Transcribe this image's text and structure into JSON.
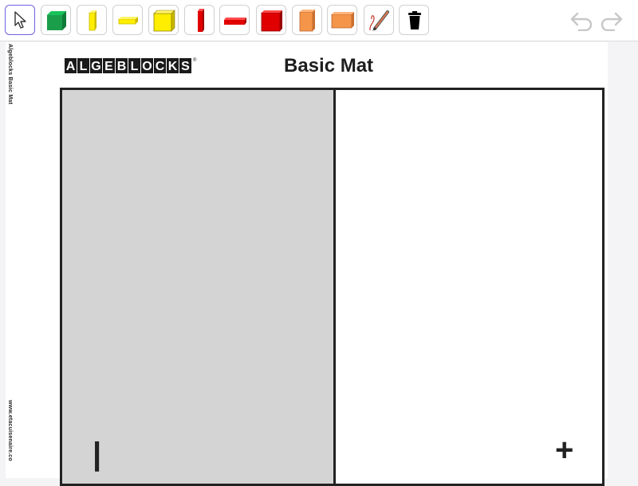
{
  "toolbar": {
    "tools": [
      {
        "name": "select-tool",
        "icon": "pointer-arrow-icon",
        "selected": true
      },
      {
        "name": "x-squared-green-tile-tool",
        "icon": "green-square-tile-icon",
        "color": "#1a9e4a"
      },
      {
        "name": "x-yellow-vertical-tool",
        "icon": "yellow-vertical-bar-icon",
        "color": "#ffee00"
      },
      {
        "name": "x-yellow-horizontal-tool",
        "icon": "yellow-horizontal-bar-icon",
        "color": "#ffee00"
      },
      {
        "name": "yellow-square-tool",
        "icon": "yellow-square-tile-icon",
        "color": "#ffee00"
      },
      {
        "name": "red-vertical-tool",
        "icon": "red-vertical-bar-icon",
        "color": "#e00000"
      },
      {
        "name": "red-horizontal-tool",
        "icon": "red-horizontal-bar-icon",
        "color": "#e00000"
      },
      {
        "name": "red-square-tool",
        "icon": "red-square-tile-icon",
        "color": "#e00000"
      },
      {
        "name": "orange-vertical-tile-tool",
        "icon": "orange-tall-tile-icon",
        "color": "#f5954a"
      },
      {
        "name": "orange-horizontal-tile-tool",
        "icon": "orange-wide-tile-icon",
        "color": "#f5954a"
      },
      {
        "name": "pen-tool",
        "icon": "pencil-icon"
      },
      {
        "name": "delete-tool",
        "icon": "trash-icon"
      }
    ],
    "undo_icon": "undo-icon",
    "redo_icon": "redo-icon"
  },
  "sheet": {
    "side_top": "Algeblocks Basic Mat",
    "side_bottom": "www.etacuisenaire.co",
    "logo_letters": [
      "A",
      "L",
      "G",
      "E",
      "B",
      "L",
      "O",
      "C",
      "K",
      "S"
    ],
    "logo_reg": "®",
    "title": "Basic Mat",
    "negative_sign": "|",
    "positive_sign": "+"
  },
  "colors": {
    "accent": "#6c63e0",
    "mat_negative": "#d4d4d4",
    "border": "#222222"
  }
}
